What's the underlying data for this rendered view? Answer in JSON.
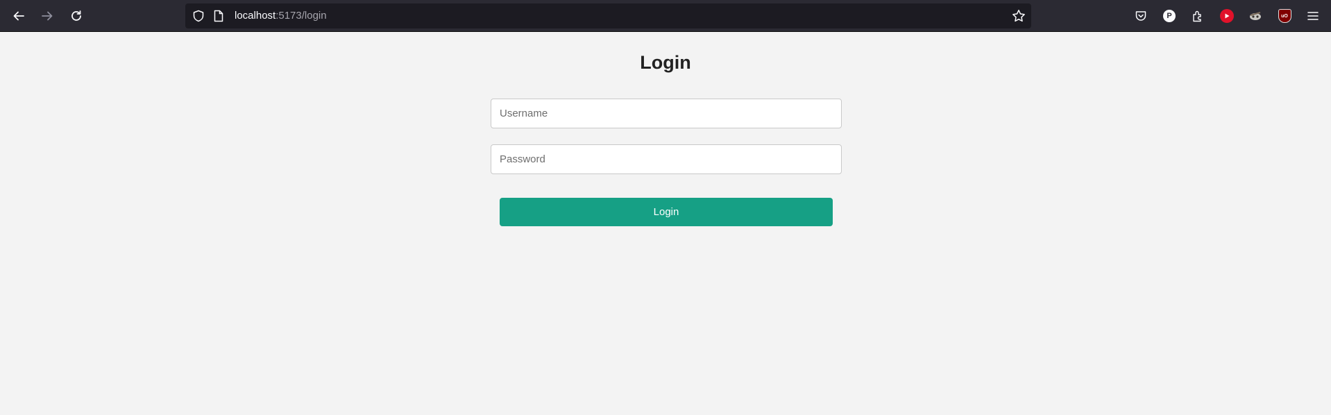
{
  "browser": {
    "url_host": "localhost",
    "url_path": ":5173/login",
    "icons": [
      "back-icon",
      "forward-icon",
      "reload-icon",
      "shield-icon",
      "page-icon",
      "bookmark-star-icon",
      "pocket-icon",
      "profile-icon",
      "extensions-icon",
      "youtube-extension-icon",
      "extension-icon",
      "ublock-origin-icon",
      "menu-icon"
    ],
    "profile_letter": "P",
    "ublock_label": "uO"
  },
  "page": {
    "title": "Login",
    "username_placeholder": "Username",
    "password_placeholder": "Password",
    "login_label": "Login"
  },
  "colors": {
    "accent": "#16a085",
    "background": "#f3f3f3",
    "toolbar": "#2b2a33"
  }
}
